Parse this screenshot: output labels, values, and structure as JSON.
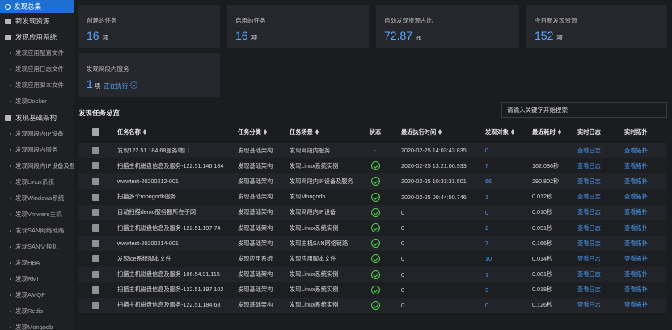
{
  "sidebar": {
    "active_item": "发现总集",
    "top_item": "新发现资源",
    "groups": [
      {
        "label": "发现应用系统",
        "items": [
          "发现应用配置文件",
          "发现应用日志文件",
          "发现应用脚本文件",
          "发现Docker"
        ]
      },
      {
        "label": "发现基础架构",
        "items": [
          "发现网段内IP设备",
          "发现网段内服务",
          "发现网段内IP设备及服务",
          "发现Linux系统",
          "发现Windows系统",
          "发现Vmware主机",
          "发现SAN网络链路",
          "发现SAN交换机",
          "发现HBA",
          "发现RMI",
          "发现AMQP",
          "发现Redis",
          "发现Mongodb"
        ]
      }
    ]
  },
  "stats": {
    "created_tasks": {
      "label": "创建的任务",
      "value": "16",
      "unit": "项"
    },
    "enabled_tasks": {
      "label": "启用的任务",
      "value": "16",
      "unit": "项"
    },
    "auto_ratio": {
      "label": "自动发现资源占比",
      "value": "72.87",
      "unit": "%"
    },
    "today_new": {
      "label": "今日新发现资源",
      "value": "152",
      "unit": "项"
    },
    "service_discovery": {
      "label": "发现网段内服务",
      "value": "1",
      "unit": "项",
      "running": "正在执行"
    }
  },
  "section": {
    "title": "发现任务总览",
    "search_placeholder": "请输入关键字开始搜索"
  },
  "table": {
    "headers": {
      "name": "任务名称",
      "category": "任务分类",
      "scene": "任务场景",
      "status": "状态",
      "last_time": "最近执行时间",
      "objects": "发现对象",
      "duration": "最近耗时",
      "log": "实时日志",
      "topo": "实时拓扑"
    },
    "rows": [
      {
        "name": "发现122.51.184.68服务端口",
        "category": "发现基础架构",
        "scene": "发现网段内服务",
        "status": "running",
        "last_time": "2020-02-25 14:03:43.835",
        "objects": "0",
        "duration": "",
        "log": "查看日志",
        "topo": "查看拓扑"
      },
      {
        "name": "扫描主机磁盘信息及服务-122.51.146.184",
        "category": "发现基础架构",
        "scene": "发现Linux系统实例",
        "status": "ok",
        "last_time": "2020-02-25 13:21:00.933",
        "objects": "7",
        "duration": "162.036秒",
        "log": "查看日志",
        "topo": "查看拓扑"
      },
      {
        "name": "wwwtest-20200212-001",
        "category": "发现基础架构",
        "scene": "发现网段内IP设备及服务",
        "status": "ok",
        "last_time": "2020-02-25 10:31:31.501",
        "objects": "66",
        "duration": "290.802秒",
        "log": "查看日志",
        "topo": "查看拓扑"
      },
      {
        "name": "扫描多个mongodb服务",
        "category": "发现基础架构",
        "scene": "发现Mongodb",
        "status": "ok",
        "last_time": "2020-02-25 00:44:50.746",
        "objects": "1",
        "duration": "0.012秒",
        "log": "查看日志",
        "topo": "查看拓扑"
      },
      {
        "name": "自动扫描demo服务器所在子网",
        "category": "发现基础架构",
        "scene": "发现网段内IP设备",
        "status": "ok",
        "last_time": "0",
        "objects": "0",
        "duration": "0.010秒",
        "log": "查看日志",
        "topo": "查看拓扑"
      },
      {
        "name": "扫描主机磁盘信息及服务-122.51.197.74",
        "category": "发现基础架构",
        "scene": "发现Linux系统实例",
        "status": "ok",
        "last_time": "0",
        "objects": "2",
        "duration": "0.091秒",
        "log": "查看日志",
        "topo": "查看拓扑"
      },
      {
        "name": "wwwtest-20200214-001",
        "category": "发现基础架构",
        "scene": "发现主机SAN网络链路",
        "status": "ok",
        "last_time": "0",
        "objects": "7",
        "duration": "0.166秒",
        "log": "查看日志",
        "topo": "查看拓扑"
      },
      {
        "name": "发现ice系统脚本文件",
        "category": "发现应用系统",
        "scene": "发现应用脚本文件",
        "status": "ok",
        "last_time": "0",
        "objects": "10",
        "duration": "0.014秒",
        "log": "查看日志",
        "topo": "查看拓扑"
      },
      {
        "name": "扫描主机磁盘信息及服务-106.54.91.115",
        "category": "发现基础架构",
        "scene": "发现Linux系统实例",
        "status": "ok",
        "last_time": "0",
        "objects": "1",
        "duration": "0.081秒",
        "log": "查看日志",
        "topo": "查看拓扑"
      },
      {
        "name": "扫描主机磁盘信息及服务-122.51.197.102",
        "category": "发现基础架构",
        "scene": "发现Linux系统实例",
        "status": "ok",
        "last_time": "0",
        "objects": "3",
        "duration": "0.018秒",
        "log": "查看日志",
        "topo": "查看拓扑"
      },
      {
        "name": "扫描主机磁盘信息及服务-122.51.184.68",
        "category": "发现基础架构",
        "scene": "发现Linux系统实例",
        "status": "ok",
        "last_time": "0",
        "objects": "0",
        "duration": "0.126秒",
        "log": "查看日志",
        "topo": "查看拓扑"
      }
    ]
  },
  "colors": {
    "accent": "#1e6fd1",
    "link": "#4a9bf5",
    "value": "#5aa9ff",
    "ok": "#4bd34b"
  }
}
